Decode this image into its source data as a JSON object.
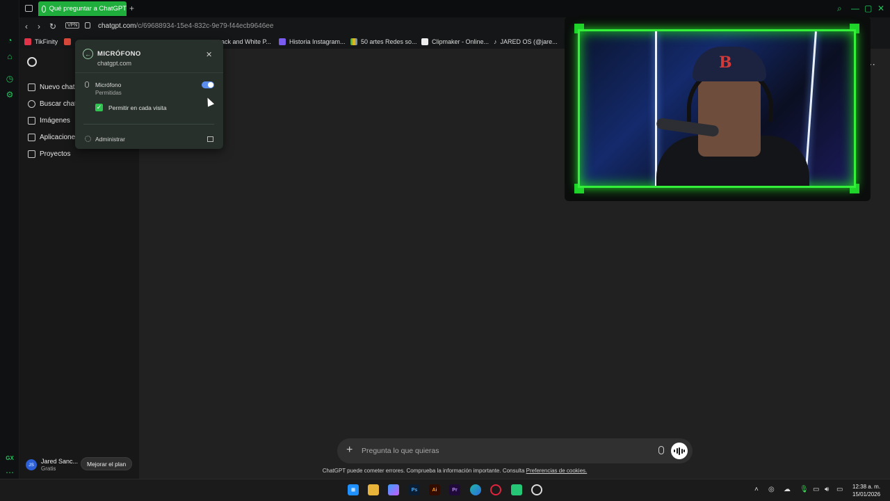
{
  "browser": {
    "active_tab": "Qué preguntar a ChatGPT",
    "url_host": "chatgpt.com",
    "url_path": "/c/69688934-15e4-832c-9e79-f44ecb9646ee",
    "vpn_label": "VPN",
    "bookmarks": [
      "TikFinity",
      "ack and White P...",
      "Historia Instagram...",
      "50 artes Redes so...",
      "Clipmaker - Online...",
      "JARED OS (@jare..."
    ]
  },
  "sidebar": {
    "items": [
      {
        "label": "Nuevo chat",
        "icon": "edit-icon"
      },
      {
        "label": "Buscar chats",
        "icon": "search-icon"
      },
      {
        "label": "Imágenes",
        "icon": "image-icon"
      },
      {
        "label": "Aplicaciones",
        "icon": "apps-icon"
      },
      {
        "label": "Proyectos",
        "icon": "folder-icon"
      }
    ],
    "user": {
      "initials": "JS",
      "name": "Jared Sanc...",
      "plan": "Gratis"
    },
    "upgrade_label": "Mejorar el plan"
  },
  "popup": {
    "title": "MICRÓFONO",
    "site": "chatgpt.com",
    "mic_label": "Micrófono",
    "mic_status": "Permitidas",
    "checkbox_label": "Permitir en cada visita",
    "manage_label": "Administrar",
    "mic_enabled": true,
    "checkbox_checked": true
  },
  "composer": {
    "placeholder": "Pregunta lo que quieras",
    "disclaimer": "ChatGPT puede cometer errores. Comprueba la información importante. Consulta",
    "disclaimer_link": "Preferencias de cookies."
  },
  "taskbar": {
    "time": "12:38 a. m.",
    "date": "15/01/2026",
    "apps": [
      "windows-start",
      "file-explorer",
      "copilot",
      "photoshop",
      "illustrator",
      "premiere",
      "edge",
      "opera-gx",
      "app-green",
      "obs"
    ]
  },
  "colors": {
    "accent": "#22c55e",
    "tab_active": "#1fae3c",
    "toggle": "#5b8def",
    "cam_border": "#34f03b"
  }
}
